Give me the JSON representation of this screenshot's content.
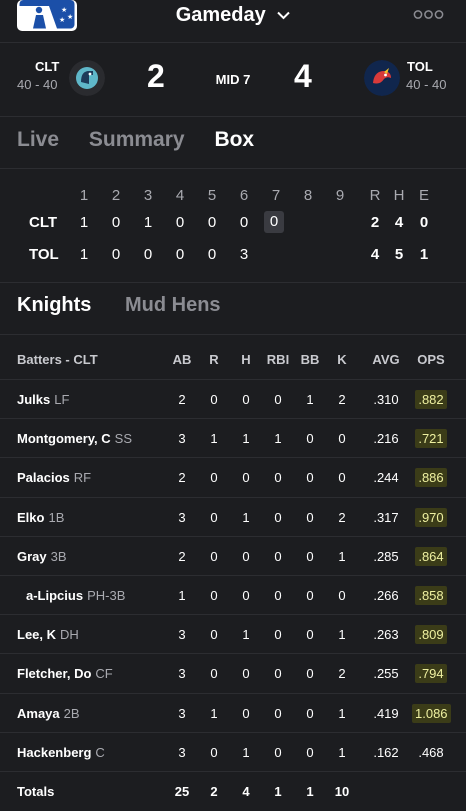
{
  "header": {
    "title": "Gameday",
    "logo": "mlb-logo",
    "more_icon": "more-dots-icon"
  },
  "scoreboard": {
    "away": {
      "abbr": "CLT",
      "record": "40 - 40",
      "score": "2"
    },
    "home": {
      "abbr": "TOL",
      "record": "40 - 40",
      "score": "4"
    },
    "inning": "MID 7"
  },
  "tabs": [
    "Live",
    "Summary",
    "Box"
  ],
  "active_tab": "Box",
  "linescore": {
    "innings": [
      "1",
      "2",
      "3",
      "4",
      "5",
      "6",
      "7",
      "8",
      "9"
    ],
    "rhe_labels": [
      "R",
      "H",
      "E"
    ],
    "teams": [
      {
        "abbr": "CLT",
        "runs": [
          "1",
          "0",
          "1",
          "0",
          "0",
          "0",
          "0",
          "",
          ""
        ],
        "rhe": [
          "2",
          "4",
          "0"
        ]
      },
      {
        "abbr": "TOL",
        "runs": [
          "1",
          "0",
          "0",
          "0",
          "0",
          "3",
          "",
          "",
          ""
        ],
        "rhe": [
          "4",
          "5",
          "1"
        ]
      }
    ]
  },
  "subtabs": [
    "Knights",
    "Mud Hens"
  ],
  "active_subtab": "Knights",
  "box": {
    "columns": [
      "Batters - CLT",
      "AB",
      "R",
      "H",
      "RBI",
      "BB",
      "K",
      "AVG",
      "OPS"
    ],
    "rows": [
      {
        "name": "Julks",
        "pos": "LF",
        "ab": "2",
        "r": "0",
        "h": "0",
        "rbi": "0",
        "bb": "1",
        "k": "2",
        "avg": ".310",
        "ops": ".882"
      },
      {
        "name": "Montgomery, C",
        "pos": "SS",
        "ab": "3",
        "r": "1",
        "h": "1",
        "rbi": "1",
        "bb": "0",
        "k": "0",
        "avg": ".216",
        "ops": ".721"
      },
      {
        "name": "Palacios",
        "pos": "RF",
        "ab": "2",
        "r": "0",
        "h": "0",
        "rbi": "0",
        "bb": "0",
        "k": "0",
        "avg": ".244",
        "ops": ".886"
      },
      {
        "name": "Elko",
        "pos": "1B",
        "ab": "3",
        "r": "0",
        "h": "1",
        "rbi": "0",
        "bb": "0",
        "k": "2",
        "avg": ".317",
        "ops": ".970"
      },
      {
        "name": "Gray",
        "pos": "3B",
        "ab": "2",
        "r": "0",
        "h": "0",
        "rbi": "0",
        "bb": "0",
        "k": "1",
        "avg": ".285",
        "ops": ".864"
      },
      {
        "name": "a-Lipcius",
        "pos": "PH-3B",
        "ab": "1",
        "r": "0",
        "h": "0",
        "rbi": "0",
        "bb": "0",
        "k": "0",
        "avg": ".266",
        "ops": ".858"
      },
      {
        "name": "Lee, K",
        "pos": "DH",
        "ab": "3",
        "r": "0",
        "h": "1",
        "rbi": "0",
        "bb": "0",
        "k": "1",
        "avg": ".263",
        "ops": ".809"
      },
      {
        "name": "Fletcher, Do",
        "pos": "CF",
        "ab": "3",
        "r": "0",
        "h": "0",
        "rbi": "0",
        "bb": "0",
        "k": "2",
        "avg": ".255",
        "ops": ".794"
      },
      {
        "name": "Amaya",
        "pos": "2B",
        "ab": "3",
        "r": "1",
        "h": "0",
        "rbi": "0",
        "bb": "0",
        "k": "1",
        "avg": ".419",
        "ops": "1.086"
      },
      {
        "name": "Hackenberg",
        "pos": "C",
        "ab": "3",
        "r": "0",
        "h": "1",
        "rbi": "0",
        "bb": "0",
        "k": "1",
        "avg": ".162",
        "ops": ".468"
      }
    ],
    "totals": {
      "label": "Totals",
      "ab": "25",
      "r": "2",
      "h": "4",
      "rbi": "1",
      "bb": "1",
      "k": "10"
    }
  },
  "colors": {
    "background": "#1c1d20",
    "ops_highlight_bg": "#3b3c18",
    "ops_highlight_text": "#eef0a0",
    "muted_text": "#8b8c92"
  }
}
